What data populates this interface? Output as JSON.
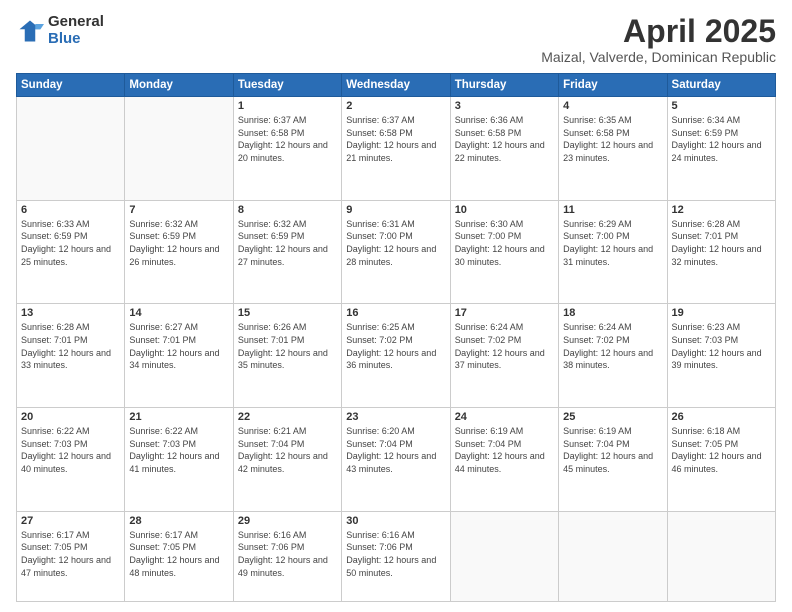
{
  "logo": {
    "general": "General",
    "blue": "Blue"
  },
  "header": {
    "title": "April 2025",
    "subtitle": "Maizal, Valverde, Dominican Republic"
  },
  "days_of_week": [
    "Sunday",
    "Monday",
    "Tuesday",
    "Wednesday",
    "Thursday",
    "Friday",
    "Saturday"
  ],
  "weeks": [
    [
      {
        "day": "",
        "info": ""
      },
      {
        "day": "",
        "info": ""
      },
      {
        "day": "1",
        "info": "Sunrise: 6:37 AM\nSunset: 6:58 PM\nDaylight: 12 hours and 20 minutes."
      },
      {
        "day": "2",
        "info": "Sunrise: 6:37 AM\nSunset: 6:58 PM\nDaylight: 12 hours and 21 minutes."
      },
      {
        "day": "3",
        "info": "Sunrise: 6:36 AM\nSunset: 6:58 PM\nDaylight: 12 hours and 22 minutes."
      },
      {
        "day": "4",
        "info": "Sunrise: 6:35 AM\nSunset: 6:58 PM\nDaylight: 12 hours and 23 minutes."
      },
      {
        "day": "5",
        "info": "Sunrise: 6:34 AM\nSunset: 6:59 PM\nDaylight: 12 hours and 24 minutes."
      }
    ],
    [
      {
        "day": "6",
        "info": "Sunrise: 6:33 AM\nSunset: 6:59 PM\nDaylight: 12 hours and 25 minutes."
      },
      {
        "day": "7",
        "info": "Sunrise: 6:32 AM\nSunset: 6:59 PM\nDaylight: 12 hours and 26 minutes."
      },
      {
        "day": "8",
        "info": "Sunrise: 6:32 AM\nSunset: 6:59 PM\nDaylight: 12 hours and 27 minutes."
      },
      {
        "day": "9",
        "info": "Sunrise: 6:31 AM\nSunset: 7:00 PM\nDaylight: 12 hours and 28 minutes."
      },
      {
        "day": "10",
        "info": "Sunrise: 6:30 AM\nSunset: 7:00 PM\nDaylight: 12 hours and 30 minutes."
      },
      {
        "day": "11",
        "info": "Sunrise: 6:29 AM\nSunset: 7:00 PM\nDaylight: 12 hours and 31 minutes."
      },
      {
        "day": "12",
        "info": "Sunrise: 6:28 AM\nSunset: 7:01 PM\nDaylight: 12 hours and 32 minutes."
      }
    ],
    [
      {
        "day": "13",
        "info": "Sunrise: 6:28 AM\nSunset: 7:01 PM\nDaylight: 12 hours and 33 minutes."
      },
      {
        "day": "14",
        "info": "Sunrise: 6:27 AM\nSunset: 7:01 PM\nDaylight: 12 hours and 34 minutes."
      },
      {
        "day": "15",
        "info": "Sunrise: 6:26 AM\nSunset: 7:01 PM\nDaylight: 12 hours and 35 minutes."
      },
      {
        "day": "16",
        "info": "Sunrise: 6:25 AM\nSunset: 7:02 PM\nDaylight: 12 hours and 36 minutes."
      },
      {
        "day": "17",
        "info": "Sunrise: 6:24 AM\nSunset: 7:02 PM\nDaylight: 12 hours and 37 minutes."
      },
      {
        "day": "18",
        "info": "Sunrise: 6:24 AM\nSunset: 7:02 PM\nDaylight: 12 hours and 38 minutes."
      },
      {
        "day": "19",
        "info": "Sunrise: 6:23 AM\nSunset: 7:03 PM\nDaylight: 12 hours and 39 minutes."
      }
    ],
    [
      {
        "day": "20",
        "info": "Sunrise: 6:22 AM\nSunset: 7:03 PM\nDaylight: 12 hours and 40 minutes."
      },
      {
        "day": "21",
        "info": "Sunrise: 6:22 AM\nSunset: 7:03 PM\nDaylight: 12 hours and 41 minutes."
      },
      {
        "day": "22",
        "info": "Sunrise: 6:21 AM\nSunset: 7:04 PM\nDaylight: 12 hours and 42 minutes."
      },
      {
        "day": "23",
        "info": "Sunrise: 6:20 AM\nSunset: 7:04 PM\nDaylight: 12 hours and 43 minutes."
      },
      {
        "day": "24",
        "info": "Sunrise: 6:19 AM\nSunset: 7:04 PM\nDaylight: 12 hours and 44 minutes."
      },
      {
        "day": "25",
        "info": "Sunrise: 6:19 AM\nSunset: 7:04 PM\nDaylight: 12 hours and 45 minutes."
      },
      {
        "day": "26",
        "info": "Sunrise: 6:18 AM\nSunset: 7:05 PM\nDaylight: 12 hours and 46 minutes."
      }
    ],
    [
      {
        "day": "27",
        "info": "Sunrise: 6:17 AM\nSunset: 7:05 PM\nDaylight: 12 hours and 47 minutes."
      },
      {
        "day": "28",
        "info": "Sunrise: 6:17 AM\nSunset: 7:05 PM\nDaylight: 12 hours and 48 minutes."
      },
      {
        "day": "29",
        "info": "Sunrise: 6:16 AM\nSunset: 7:06 PM\nDaylight: 12 hours and 49 minutes."
      },
      {
        "day": "30",
        "info": "Sunrise: 6:16 AM\nSunset: 7:06 PM\nDaylight: 12 hours and 50 minutes."
      },
      {
        "day": "",
        "info": ""
      },
      {
        "day": "",
        "info": ""
      },
      {
        "day": "",
        "info": ""
      }
    ]
  ]
}
